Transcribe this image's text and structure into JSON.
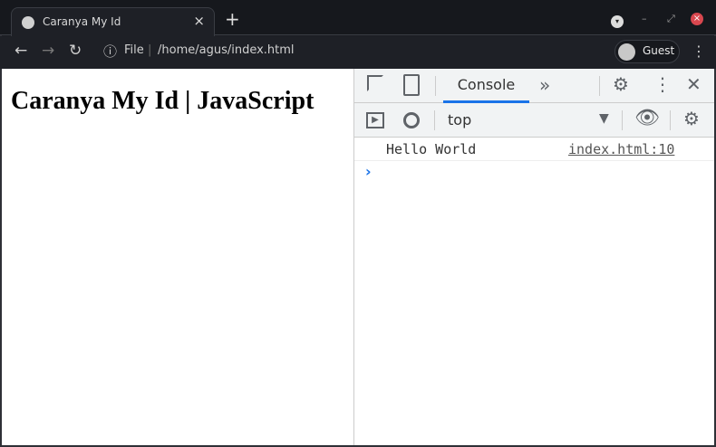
{
  "tab": {
    "title": "Caranya My Id",
    "close": "×",
    "new_tab": "+"
  },
  "toolbar": {
    "back": "←",
    "forward": "→",
    "reload": "↻",
    "info": "ⓘ",
    "scheme": "File",
    "separator": "|",
    "path": "/home/agus/index.html",
    "profile": "Guest",
    "menu": "⋮"
  },
  "window": {
    "dropdown": "▾",
    "minimize": "–",
    "maximize": "⤢",
    "close": "×"
  },
  "page": {
    "heading": "Caranya My Id | JavaScript"
  },
  "devtools": {
    "tab": "Console",
    "more": "»",
    "context": "top",
    "messages": [
      {
        "text": "Hello World",
        "source": "index.html:10"
      }
    ],
    "prompt": "›"
  }
}
